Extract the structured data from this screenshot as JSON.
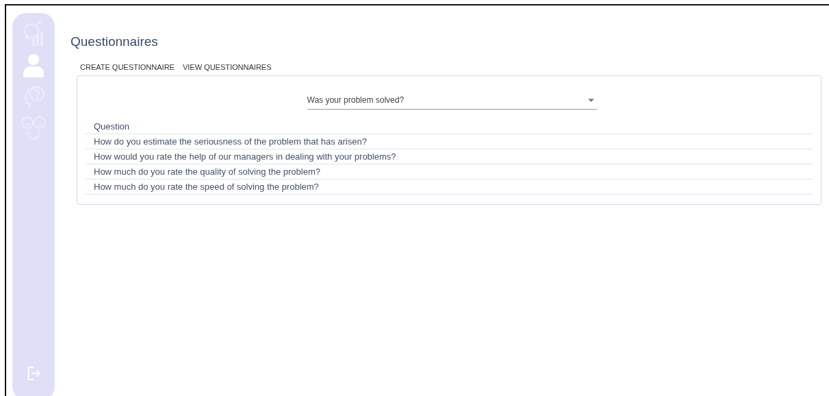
{
  "sidebar": {
    "items": [
      {
        "kind": "analytics",
        "selected": false
      },
      {
        "kind": "user",
        "selected": true
      },
      {
        "kind": "help",
        "selected": false
      },
      {
        "kind": "moods",
        "selected": false
      }
    ],
    "footer": {
      "kind": "logout"
    }
  },
  "page": {
    "title": "Questionnaires"
  },
  "tabs": [
    {
      "label": "CREATE QUESTIONNAIRE"
    },
    {
      "label": "VIEW QUESTIONNAIRES"
    }
  ],
  "select": {
    "value": "Was your problem solved?"
  },
  "table": {
    "columns": [
      "Question"
    ],
    "rows": [
      "How do you estimate the seriousness of the problem that has arisen?",
      "How would you rate the help of our managers in dealing with your problems?",
      "How much do you rate the quality of solving the problem?",
      "How much do you rate the speed of solving the problem?"
    ]
  }
}
